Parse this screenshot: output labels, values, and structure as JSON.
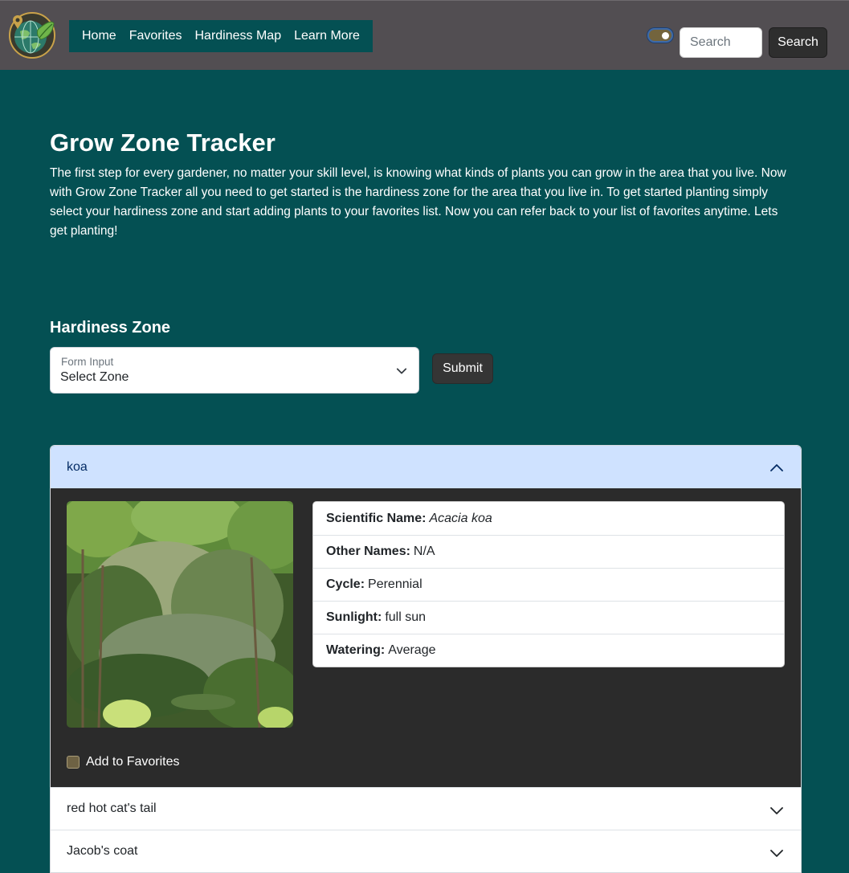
{
  "navbar": {
    "links": [
      "Home",
      "Favorites",
      "Hardiness Map",
      "Learn More"
    ],
    "search_placeholder": "Search",
    "search_button": "Search"
  },
  "hero": {
    "title": "Grow Zone Tracker",
    "description": "The first step for every gardener, no matter your skill level, is knowing what kinds of plants you can grow in the area that you live. Now with Grow Zone Tracker all you need to get started is the hardiness zone for the area that you live in. To get started planting simply select your hardiness zone and start adding plants to your favorites list. Now you can refer back to your list of favorites anytime. Lets get planting!"
  },
  "zone_form": {
    "heading": "Hardiness Zone",
    "select_label": "Form Input",
    "select_value": "Select Zone",
    "submit_label": "Submit"
  },
  "plants": [
    {
      "name": "koa",
      "expanded": true,
      "details": {
        "scientific_label": "Scientific Name:",
        "scientific_value": "Acacia koa",
        "other_label": "Other Names:",
        "other_value": "N/A",
        "cycle_label": "Cycle:",
        "cycle_value": "Perennial",
        "sunlight_label": "Sunlight:",
        "sunlight_value": "full sun",
        "watering_label": "Watering:",
        "watering_value": "Average"
      },
      "favorite_label": "Add to Favorites",
      "favorite_checked": false
    },
    {
      "name": "red hot cat's tail",
      "expanded": false
    },
    {
      "name": "Jacob's coat",
      "expanded": false
    }
  ],
  "colors": {
    "page_bg": "#045053",
    "navbar_bg": "#524e52",
    "accordion_open_bg": "#cfe2ff",
    "accordion_body_bg": "#2b2b2b"
  }
}
